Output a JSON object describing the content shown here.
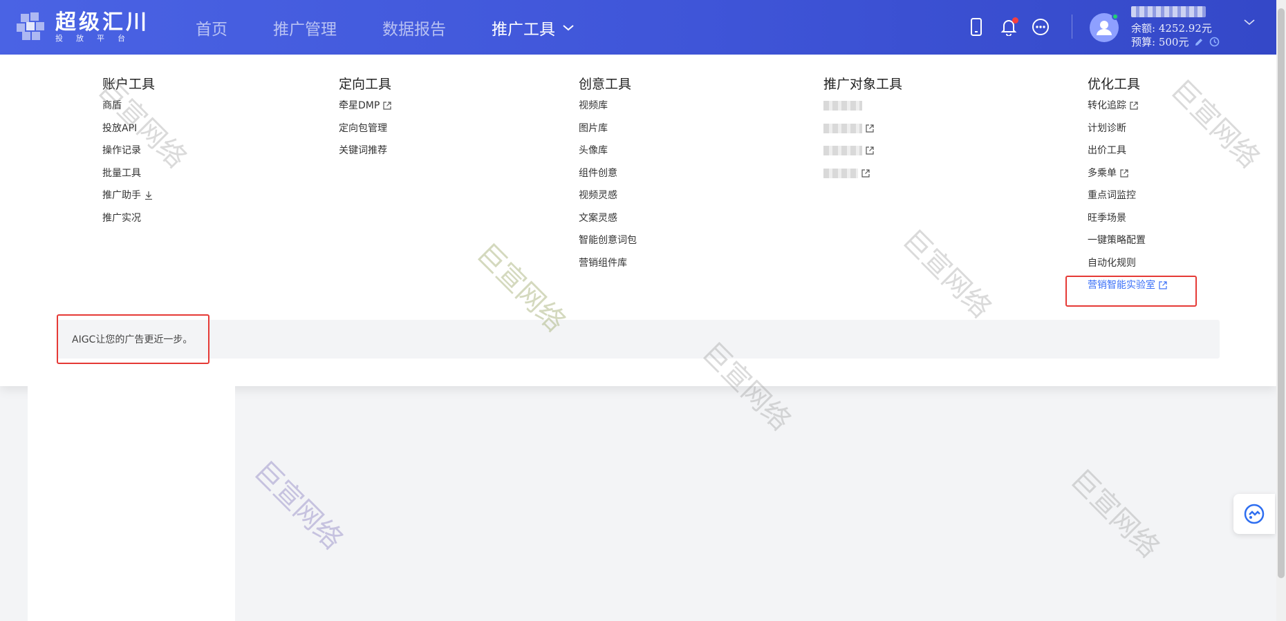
{
  "header": {
    "logo_title": "超级汇川",
    "logo_sub": "投放平台",
    "nav": [
      {
        "label": "首页"
      },
      {
        "label": "推广管理"
      },
      {
        "label": "数据报告"
      },
      {
        "label": "推广工具"
      }
    ],
    "account": {
      "balance": "余额: 4252.92元",
      "budget": "预算: 500元"
    }
  },
  "menu": {
    "columns": [
      {
        "title": "账户工具",
        "items": [
          {
            "label": "商盾"
          },
          {
            "label": "投放API"
          },
          {
            "label": "操作记录"
          },
          {
            "label": "批量工具"
          },
          {
            "label": "推广助手"
          },
          {
            "label": "推广实况"
          }
        ]
      },
      {
        "title": "定向工具",
        "items": [
          {
            "label": "牵星DMP"
          },
          {
            "label": "定向包管理"
          },
          {
            "label": "关键词推荐"
          }
        ]
      },
      {
        "title": "创意工具",
        "items": [
          {
            "label": "视频库"
          },
          {
            "label": "图片库"
          },
          {
            "label": "头像库"
          },
          {
            "label": "组件创意"
          },
          {
            "label": "视频灵感"
          },
          {
            "label": "文案灵感"
          },
          {
            "label": "智能创意词包"
          },
          {
            "label": "营销组件库"
          }
        ]
      },
      {
        "title": "推广对象工具",
        "items": [
          {
            "label": ""
          },
          {
            "label": ""
          },
          {
            "label": ""
          },
          {
            "label": ""
          }
        ]
      },
      {
        "title": "优化工具",
        "items": [
          {
            "label": "转化追踪"
          },
          {
            "label": "计划诊断"
          },
          {
            "label": "出价工具"
          },
          {
            "label": "多乘单"
          },
          {
            "label": "重点词监控"
          },
          {
            "label": "旺季场景"
          },
          {
            "label": "一键策略配置"
          },
          {
            "label": "自动化规则"
          },
          {
            "label": "营销智能实验室"
          }
        ]
      }
    ],
    "banner_text": "AIGC让您的广告更近一步。"
  },
  "watermark": "巨宣网络",
  "colors": {
    "header_start": "#4a63e4",
    "header_end": "#3448c8",
    "highlight_link": "#3a6ff7",
    "annotation_red": "#e53935",
    "notification_dot": "#f53f3f",
    "online_dot": "#20d070"
  }
}
